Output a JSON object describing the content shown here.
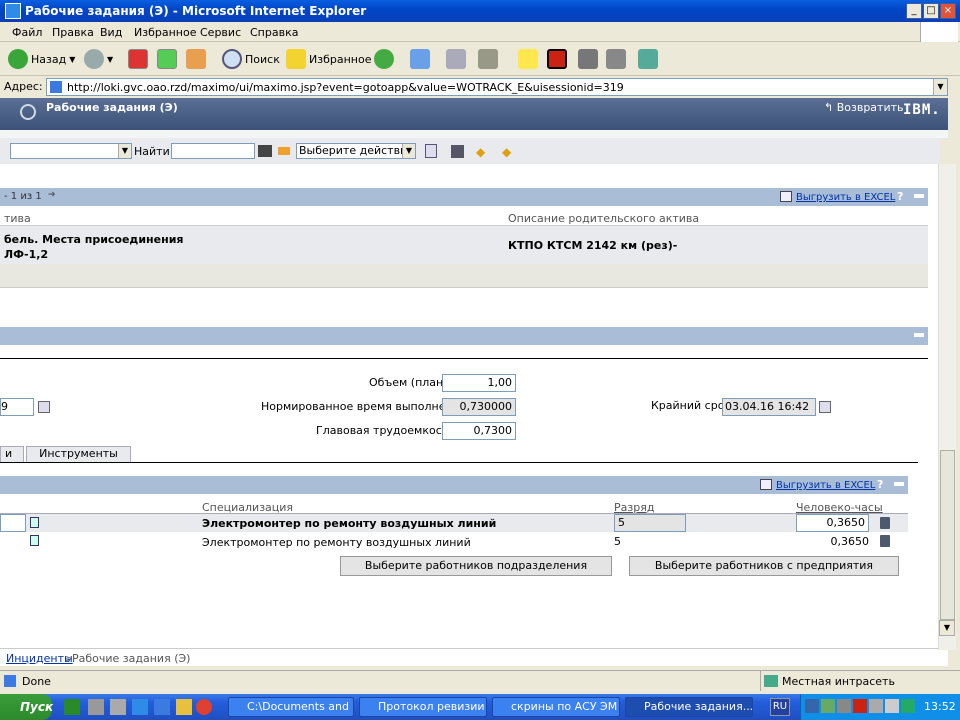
{
  "window": {
    "title": "Рабочие задания (Э) - Microsoft Internet Explorer"
  },
  "menu": [
    "Файл",
    "Правка",
    "Вид",
    "Избранное",
    "Сервис",
    "Справка"
  ],
  "toolbar": {
    "back": "Назад",
    "search": "Поиск",
    "favorites": "Избранное"
  },
  "address": {
    "label": "Адрес:",
    "url": "http://loki.gvc.oao.rzd/maximo/ui/maximo.jsp?event=gotoapp&value=WOTRACK_E&uisessionid=319"
  },
  "app": {
    "title": "Рабочие задания (Э)",
    "back_label": "Возвратить",
    "brand": "IBM."
  },
  "mxtoolbar": {
    "find_label": "Найти:",
    "action_select": "Выберите действие"
  },
  "assets": {
    "pager": "- 1 из 1",
    "export": "Выгрузить в EXCEL",
    "help": "?",
    "col_asset": "тива",
    "col_parent": "Описание родительского актива",
    "row_line1": "бель. Места присоединения",
    "row_line2": "ЛФ-1,2",
    "row_parent": "КТПО КТСМ 2142 км (рез)-"
  },
  "plan": {
    "volume_label": "Объем (план)",
    "volume_value": "1,00",
    "left_value": "9",
    "norm_label": "Нормированное время выполнения",
    "norm_value": "0,730000",
    "deadline_label": "Крайний срок",
    "deadline_value": "03.04.16 16:42",
    "labor_label": "Главовая трудоемкость",
    "labor_value": "0,7300"
  },
  "tabs": [
    "и",
    "Инструменты"
  ],
  "labor": {
    "export": "Выгрузить в EXCEL",
    "help": "?",
    "col_spec": "Специализация",
    "col_grade": "Разряд",
    "col_hours": "Человеко-часы",
    "rows": [
      {
        "spec": "Электромонтер по ремонту воздушных линий",
        "grade": "5",
        "hours": "0,3650"
      },
      {
        "spec": "Электромонтер по ремонту воздушных линий",
        "grade": "5",
        "hours": "0,3650"
      }
    ],
    "btn_dept": "Выберите работников подразделения",
    "btn_ent": "Выберите работников с предприятия"
  },
  "breadcrumb": {
    "link": "Инциденты",
    "sep": " > ",
    "current": "Рабочие задания (Э)"
  },
  "status": {
    "left": "Done",
    "zone": "Местная интрасеть"
  },
  "taskbar": {
    "start": "Пуск",
    "tasks": [
      "C:\\Documents and S...",
      "Протокол ревизии ...",
      "скрины по АСУ ЭМ ...",
      "Рабочие задания..."
    ],
    "lang": "RU",
    "clock": "13:52"
  }
}
